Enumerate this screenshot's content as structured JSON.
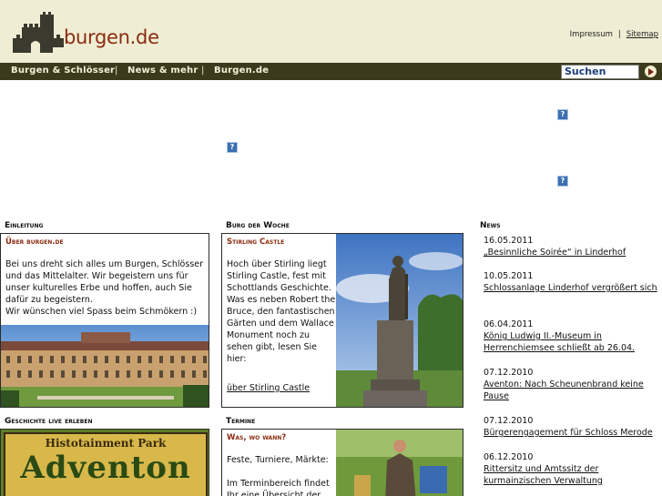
{
  "header": {
    "logo_text": "burgen.de",
    "links": [
      "Impressum",
      "Sitemap"
    ]
  },
  "nav": {
    "items": [
      "Burgen & Schlösser",
      "News & mehr",
      "Burgen.de"
    ],
    "search_value": "Suchen"
  },
  "placeholder_icon": "?",
  "sections": {
    "intro": {
      "title": "Einleitung",
      "head": "Über burgen.de",
      "text": "Bei uns dreht sich alles um Burgen, Schlösser und das Mittelalter. Wir begeistern uns für unser kulturelles Erbe und hoffen, auch Sie dafür zu begeistern.\nWir wünschen viel Spass beim Schmökern :)"
    },
    "castle": {
      "title": "Burg der Woche",
      "head": "Stirling Castle",
      "text": "Hoch über Stirling liegt Stirling Castle, fest mit Schottlands Geschichte. Was es neben Robert the Bruce, den fantastischen Gärten und dem Wallace Monument noch zu sehen gibt, lesen Sie hier:",
      "link": "über Stirling Castle"
    },
    "history": {
      "title": "Geschichte live erleben",
      "banner_line1": "Histotainment Park",
      "banner_line2": "Adventon"
    },
    "termine": {
      "title": "Termine",
      "head": "Was, wo wann?",
      "text": "Feste, Turniere, Märkte:\n\nIm Terminbereich findet Ihr eine Übersicht der"
    }
  },
  "news": {
    "title": "News",
    "items": [
      {
        "date": "16.05.2011",
        "text": "„Besinnliche Soirée“ in Linderhof"
      },
      {
        "date": "10.05.2011",
        "text": "Schlossanlage Linderhof vergrößert sich"
      },
      {
        "date": "06.04.2011",
        "text": "König Ludwig II.-Museum in Herrenchiemsee schließt ab 26.04."
      },
      {
        "date": "07.12.2010",
        "text": "Aventon: Nach Scheunenbrand keine Pause"
      },
      {
        "date": "07.12.2010",
        "text": "Bürgerengagement für Schloss Merode"
      },
      {
        "date": "06.12.2010",
        "text": "Rittersitz und Amtssitz der kurmainzischen Verwaltung"
      }
    ]
  },
  "colors": {
    "header_bg": "#efeed5",
    "nav_bg": "#3b3a1c",
    "accent": "#8b2b10"
  },
  "icons": {
    "logo": "castle-logo-icon",
    "search_go": "arrow-right-icon",
    "placeholder": "broken-image-icon"
  }
}
